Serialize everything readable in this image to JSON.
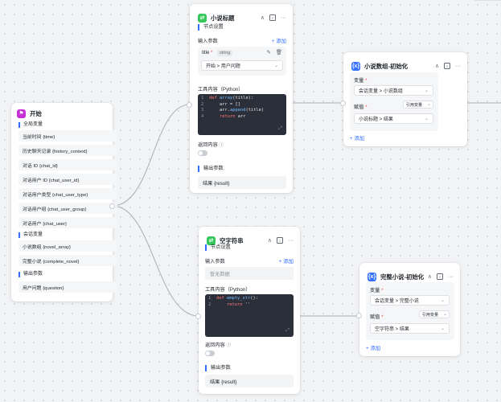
{
  "colors": {
    "accent": "#3370ff",
    "green_badge": "#34c759",
    "purple_badge": "#c42fd6",
    "code_bg": "#2b2f3a"
  },
  "start_node": {
    "title": "开始",
    "icon": "flag-icon",
    "global_vars_label": "全局变量",
    "global_vars": [
      "当前时间 {time}",
      "历史聊天记录 {history_context}",
      "对话 ID {chat_id}",
      "对话用户 ID {chat_user_id}",
      "对话用户类型 {chat_user_type}",
      "对话用户组 {chat_user_group}",
      "对话用户 {chat_user}"
    ],
    "session_vars_label": "会话变量",
    "session_vars": [
      "小说数组 {novel_array}",
      "完整小说 {complete_novel}"
    ],
    "output_label": "输出参数",
    "outputs": [
      "用户问题 {question}"
    ]
  },
  "novel_title_node": {
    "title": "小说标题",
    "node_settings": "节点设置",
    "input_params": "输入参数",
    "add": "+ 添加",
    "param_name": "title",
    "param_required": "*",
    "param_type": "string",
    "param_value": "开始 > 用户问题",
    "tool_content": "工具内容（Python）",
    "code": [
      {
        "n": "1",
        "t": "def array(title):"
      },
      {
        "n": "2",
        "t": "    arr = []"
      },
      {
        "n": "3",
        "t": "    arr.append(title)"
      },
      {
        "n": "4",
        "t": "    return arr"
      }
    ],
    "return_content": "返回内容",
    "output_params": "输出参数",
    "output": "结果 {result}"
  },
  "novel_array_init_node": {
    "title": "小说数组-初始化",
    "var_label": "变量",
    "var_required": "*",
    "var_value": "会话变量 > 小说数组",
    "assign_label": "赋值",
    "assign_required": "*",
    "ref_var": "引用变量",
    "assign_value": "小说标题 > 结果",
    "add": "+ 添加"
  },
  "empty_string_node": {
    "title": "空字符串",
    "node_settings": "节点设置",
    "input_params": "输入参数",
    "add": "+ 添加",
    "no_data": "暂无数据",
    "tool_content": "工具内容（Python）",
    "code": [
      {
        "n": "1",
        "t": "def empty_str():"
      },
      {
        "n": "2",
        "t": "    return ''"
      }
    ],
    "return_content": "返回内容",
    "output_params": "输出参数",
    "output": "结果 {result}"
  },
  "complete_novel_init_node": {
    "title": "完整小说-初始化",
    "var_label": "变量",
    "var_required": "*",
    "var_value": "会话变量 > 完整小说",
    "assign_label": "赋值",
    "assign_required": "*",
    "ref_var": "引用变量",
    "assign_value": "空字符串 > 结果",
    "add": "+ 添加"
  }
}
